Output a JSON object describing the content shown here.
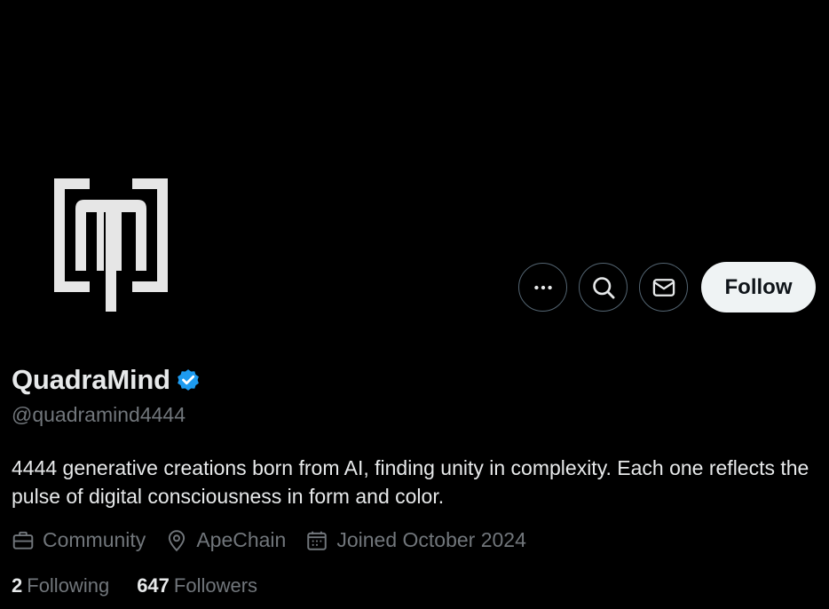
{
  "profile": {
    "display_name": "QuadraMind",
    "verified": true,
    "handle": "@quadramind4444",
    "bio": "4444 generative creations born from AI, finding unity in complexity. Each one reflects the pulse of digital consciousness in form and color.",
    "category": "Community",
    "location": "ApeChain",
    "joined": "Joined October 2024",
    "following_count": "2",
    "following_label": "Following",
    "followers_count": "647",
    "followers_label": "Followers"
  },
  "actions": {
    "more_icon": "more-horizontal-icon",
    "search_icon": "search-icon",
    "message_icon": "envelope-icon",
    "follow_label": "Follow"
  },
  "colors": {
    "background": "#000000",
    "primary_text": "#e7e9ea",
    "secondary_text": "#71767b",
    "verified_badge": "#1d9bf0",
    "follow_button_bg": "#eff3f4",
    "icon_button_border": "#536471"
  }
}
